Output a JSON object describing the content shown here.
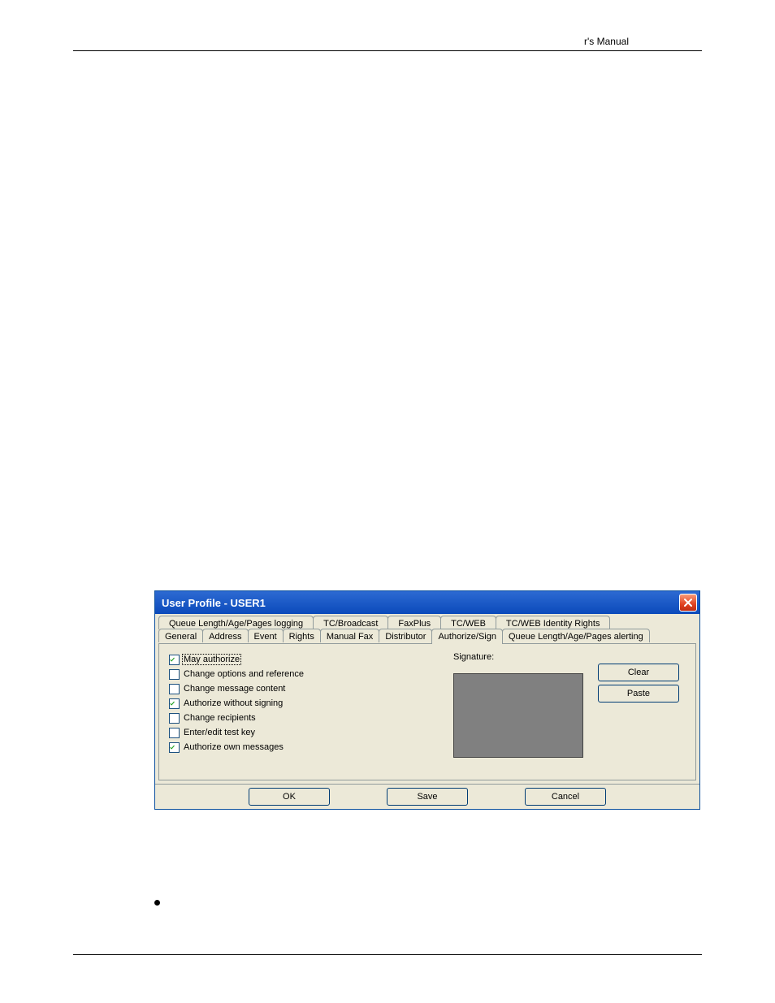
{
  "doc": {
    "header_text": "r's Manual"
  },
  "dialog": {
    "title": "User Profile - USER1",
    "tabs_upper": [
      "Queue Length/Age/Pages logging",
      "TC/Broadcast",
      "FaxPlus",
      "TC/WEB",
      "TC/WEB Identity Rights"
    ],
    "tabs_lower": [
      "General",
      "Address",
      "Event",
      "Rights",
      "Manual Fax",
      "Distributor",
      "Authorize/Sign",
      "Queue Length/Age/Pages alerting"
    ],
    "active_tab": "Authorize/Sign",
    "checkboxes": [
      {
        "label": "May authorize",
        "checked": true,
        "focused": true
      },
      {
        "label": "Change options and reference",
        "checked": false,
        "focused": false
      },
      {
        "label": "Change message content",
        "checked": false,
        "focused": false
      },
      {
        "label": "Authorize without signing",
        "checked": true,
        "focused": false
      },
      {
        "label": "Change recipients",
        "checked": false,
        "focused": false
      },
      {
        "label": "Enter/edit test key",
        "checked": false,
        "focused": false
      },
      {
        "label": "Authorize own messages",
        "checked": true,
        "focused": false
      }
    ],
    "signature_label": "Signature:",
    "buttons": {
      "clear": "Clear",
      "paste": "Paste",
      "ok": "OK",
      "save": "Save",
      "cancel": "Cancel"
    }
  }
}
